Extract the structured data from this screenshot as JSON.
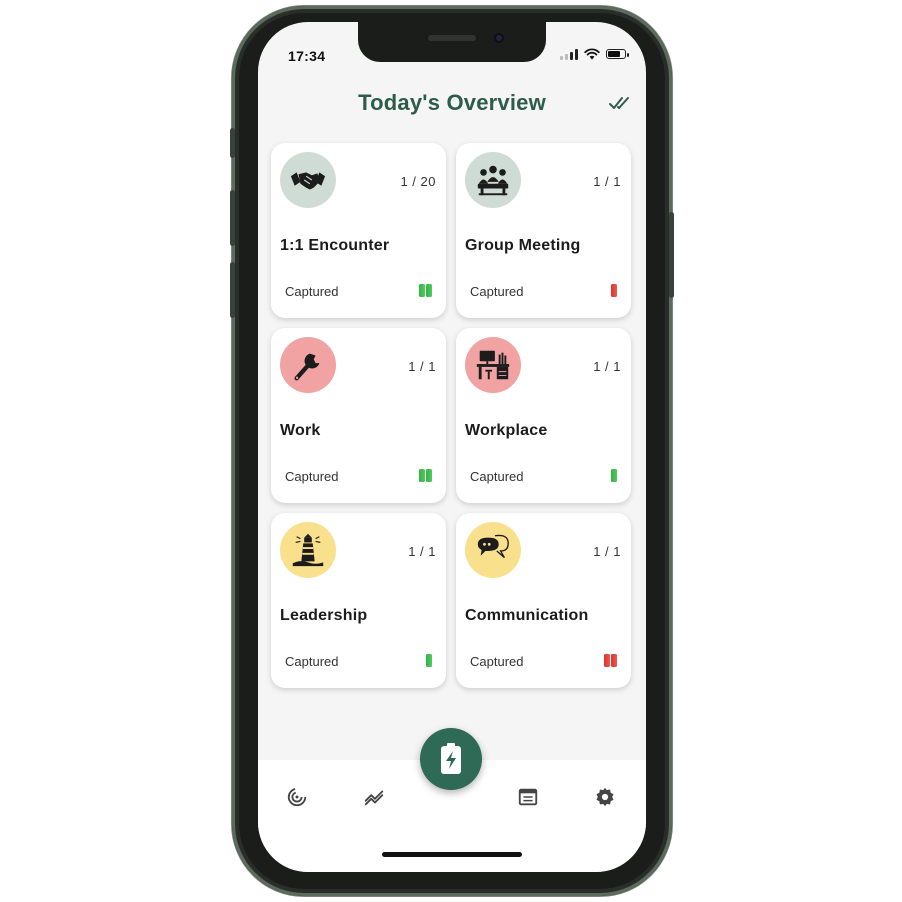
{
  "status_bar": {
    "time": "17:34"
  },
  "header": {
    "title": "Today's Overview",
    "action_icon": "double-check-icon"
  },
  "cards": [
    {
      "name": "1:1 Encounter",
      "count": "1 / 20",
      "status": "Captured",
      "icon": "handshake-icon",
      "avatar_color": "#cfdcd6",
      "battery_color": "#2db83d",
      "battery_count": 2
    },
    {
      "name": "Group Meeting",
      "count": "1 / 1",
      "status": "Captured",
      "icon": "group-meeting-icon",
      "avatar_color": "#cfdcd6",
      "battery_color": "#e0322b",
      "battery_count": 1
    },
    {
      "name": "Work",
      "count": "1 / 1",
      "status": "Captured",
      "icon": "wrench-icon",
      "avatar_color": "#f1a3a3",
      "battery_color": "#2db83d",
      "battery_count": 2
    },
    {
      "name": "Workplace",
      "count": "1 / 1",
      "status": "Captured",
      "icon": "desk-icon",
      "avatar_color": "#f1a3a3",
      "battery_color": "#2db83d",
      "battery_count": 1
    },
    {
      "name": "Leadership",
      "count": "1 / 1",
      "status": "Captured",
      "icon": "lighthouse-icon",
      "avatar_color": "#f9e08c",
      "battery_color": "#2db83d",
      "battery_count": 1
    },
    {
      "name": "Communication",
      "count": "1 / 1",
      "status": "Captured",
      "icon": "speech-bubbles-icon",
      "avatar_color": "#f9e08c",
      "battery_color": "#e0322b",
      "battery_count": 2
    }
  ],
  "bottom_nav": {
    "items": [
      "radar-icon",
      "trend-icon",
      "battery-bolt-icon",
      "calendar-icon",
      "gear-icon"
    ],
    "accent_color": "#2e6a55"
  }
}
